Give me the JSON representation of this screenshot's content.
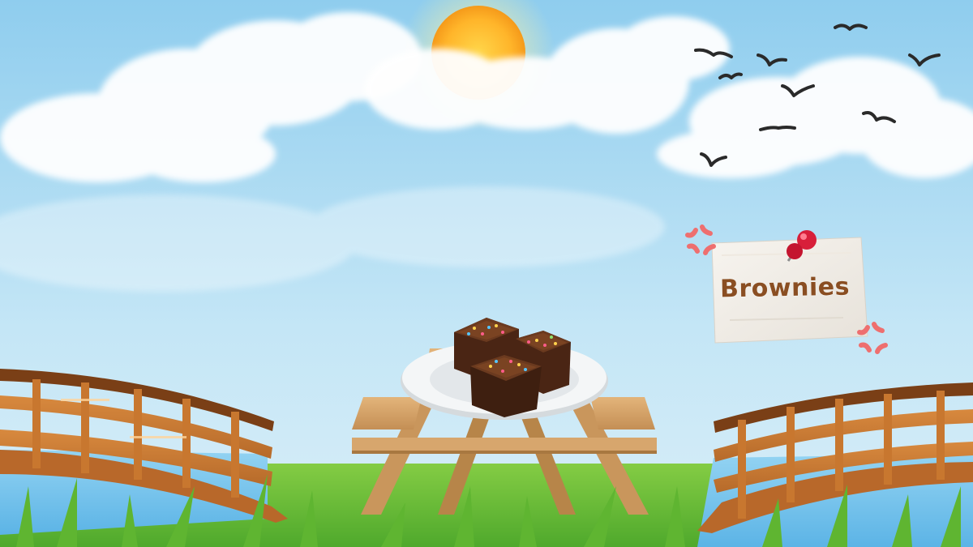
{
  "scene": {
    "sign": {
      "label": "Brownies"
    },
    "item": {
      "name": "brownie",
      "count": 3
    }
  },
  "icons": [
    "sun-icon",
    "bird-icon",
    "push-pin-icon",
    "anger-symbol-icon",
    "brownie-icon"
  ],
  "colors": {
    "sky": "#bfe3f5",
    "grass": "#6bbf3a",
    "water": "#7ec8ef",
    "bridge": "#c97a35",
    "bridge_top": "#7a3f16",
    "table_wood": "#d9aa70",
    "plate": "#eef1f3",
    "pin": "#d81f3a",
    "anger": "#ee6f6f",
    "label": "#8a4e22"
  }
}
